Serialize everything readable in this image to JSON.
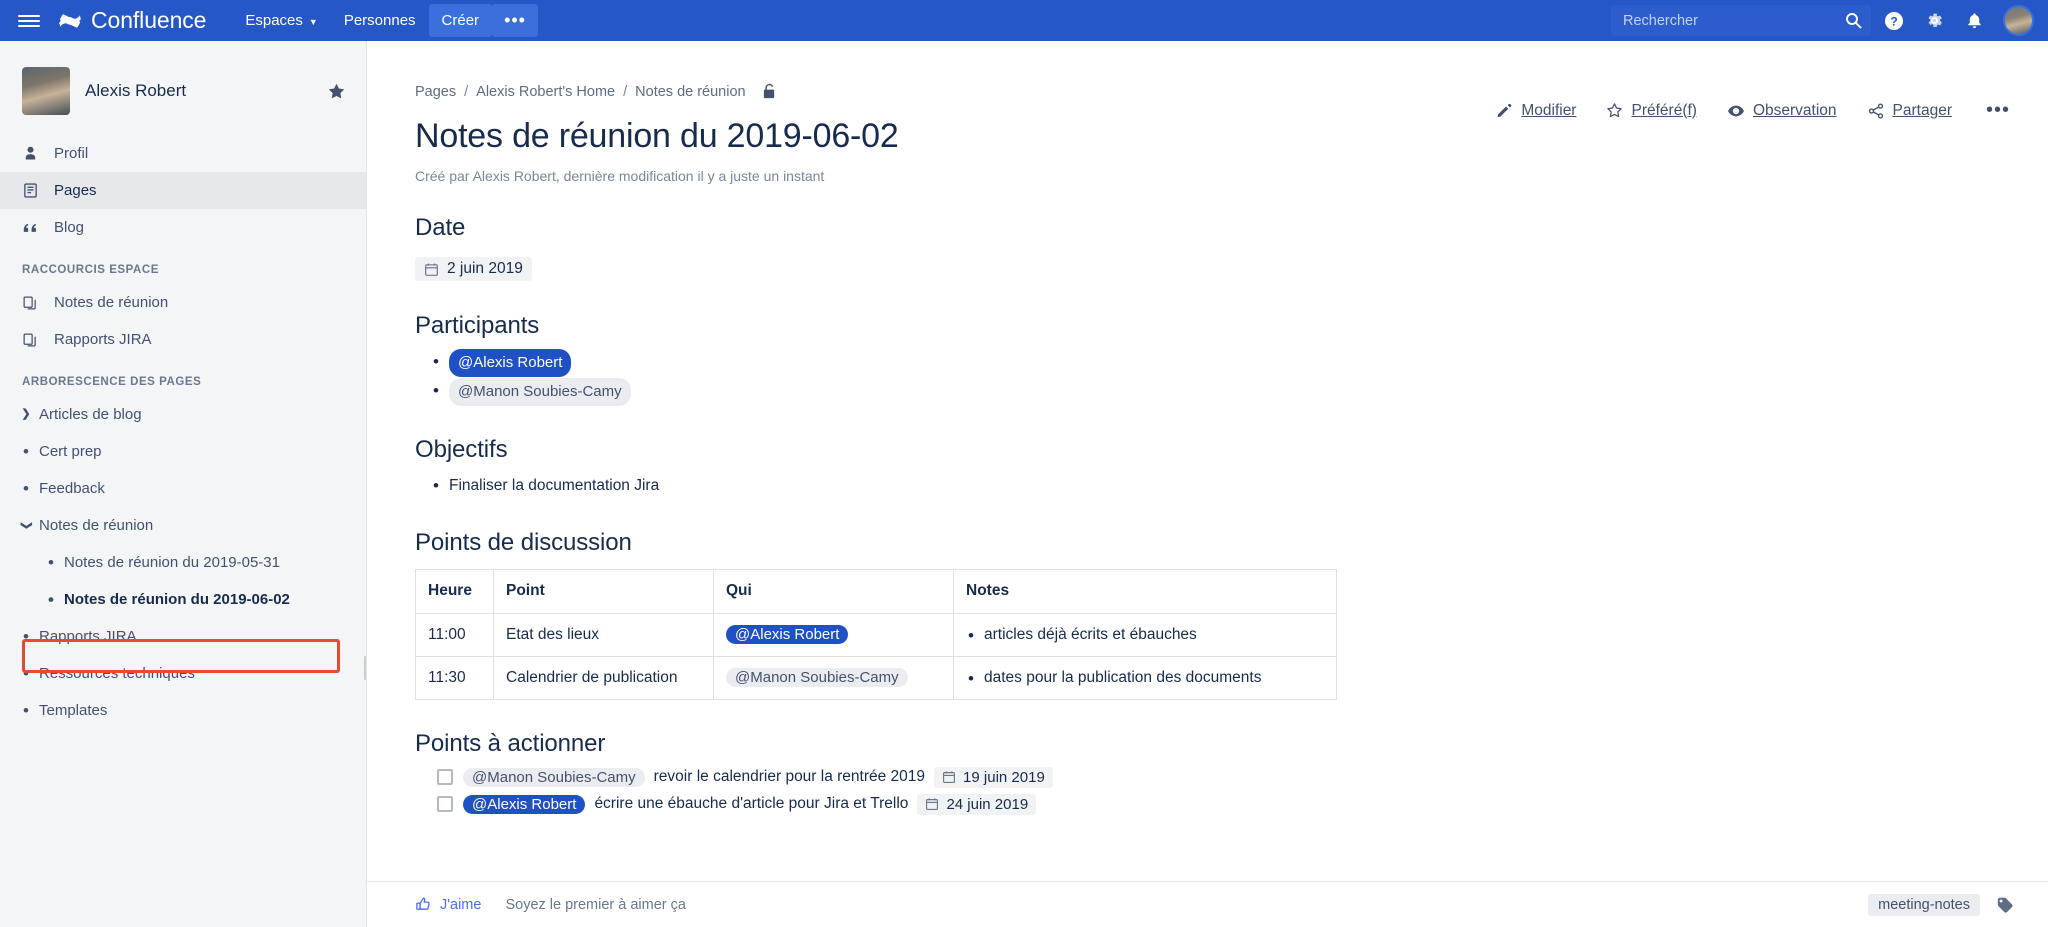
{
  "topnav": {
    "menu_icon": "hamburger-icon",
    "brand": "Confluence",
    "brand_logo_icon": "confluence-logo-icon",
    "items": [
      {
        "label": "Espaces",
        "has_caret": true
      },
      {
        "label": "Personnes",
        "has_caret": false
      }
    ],
    "create_label": "Créer",
    "more_label": "•••",
    "search": {
      "placeholder": "Rechercher",
      "value": "",
      "icon": "search-icon"
    },
    "help_icon": "help-circle-icon",
    "settings_icon": "gear-icon",
    "notifications_icon": "bell-icon",
    "avatar": "user-avatar"
  },
  "sidebar": {
    "space_name": "Alexis Robert",
    "star_icon": "star-filled-icon",
    "nav": [
      {
        "label": "Profil",
        "icon": "person-icon",
        "active": false
      },
      {
        "label": "Pages",
        "icon": "page-icon",
        "active": true
      },
      {
        "label": "Blog",
        "icon": "quote-icon",
        "active": false
      }
    ],
    "shortcuts_title": "RACCOURCIS ESPACE",
    "shortcuts": [
      {
        "label": "Notes de réunion",
        "icon": "copy-page-icon"
      },
      {
        "label": "Rapports JIRA",
        "icon": "copy-page-icon"
      }
    ],
    "tree_title": "ARBORESCENCE DES PAGES",
    "tree": [
      {
        "label": "Articles de blog",
        "marker": "chevron-right",
        "level": 1,
        "current": false
      },
      {
        "label": "Cert prep",
        "marker": "dot",
        "level": 1,
        "current": false
      },
      {
        "label": "Feedback",
        "marker": "dot",
        "level": 1,
        "current": false
      },
      {
        "label": "Notes de réunion",
        "marker": "chevron-down",
        "level": 1,
        "current": false
      },
      {
        "label": "Notes de réunion du 2019-05-31",
        "marker": "dot",
        "level": 2,
        "current": false
      },
      {
        "label": "Notes de réunion du 2019-06-02",
        "marker": "dot",
        "level": 2,
        "current": true
      },
      {
        "label": "Rapports JIRA",
        "marker": "dot",
        "level": 1,
        "current": false
      },
      {
        "label": "Ressources techniques",
        "marker": "dot",
        "level": 1,
        "current": false
      },
      {
        "label": "Templates",
        "marker": "dot",
        "level": 1,
        "current": false
      }
    ],
    "highlight_color": "#e8492f"
  },
  "page": {
    "breadcrumb": [
      {
        "label": "Pages"
      },
      {
        "label": "Alexis Robert's Home"
      },
      {
        "label": "Notes de réunion"
      }
    ],
    "breadcrumb_sep": "/",
    "restrictions_icon": "lock-unlocked-icon",
    "title": "Notes de réunion du 2019-06-02",
    "byline": "Créé par Alexis Robert, dernière modification il y a juste un instant",
    "actions": [
      {
        "label": "Modifier",
        "icon": "pencil-icon",
        "underline_index": 0
      },
      {
        "label": "Préféré(f)",
        "icon": "star-outline-icon"
      },
      {
        "label": "Observation",
        "icon": "eye-icon"
      },
      {
        "label": "Partager",
        "icon": "share-icon"
      }
    ],
    "more_actions": "•••"
  },
  "content": {
    "date_heading": "Date",
    "date_value": "2 juin 2019",
    "date_icon": "calendar-icon",
    "participants_heading": "Participants",
    "participants": [
      {
        "name": "@Alexis Robert",
        "style": "me"
      },
      {
        "name": "@Manon Soubies-Camy",
        "style": "other"
      }
    ],
    "objectifs_heading": "Objectifs",
    "objectifs": [
      "Finaliser la documentation Jira"
    ],
    "discussion_heading": "Points de discussion",
    "table": {
      "headers": [
        "Heure",
        "Point",
        "Qui",
        "Notes"
      ],
      "rows": [
        {
          "heure": "11:00",
          "point": "Etat des lieux",
          "qui": "@Alexis Robert",
          "qui_style": "me",
          "notes": [
            "articles déjà écrits et ébauches"
          ]
        },
        {
          "heure": "11:30",
          "point": "Calendrier de publication",
          "qui": "@Manon Soubies-Camy",
          "qui_style": "other",
          "notes": [
            "dates pour la publication des documents"
          ]
        }
      ]
    },
    "actions_heading": "Points à actionner",
    "action_items": [
      {
        "checked": false,
        "mention": "@Manon Soubies-Camy",
        "mention_style": "other",
        "text": "revoir le calendrier pour la rentrée 2019",
        "date": "19 juin 2019",
        "date_icon": "calendar-icon"
      },
      {
        "checked": false,
        "mention": "@Alexis Robert",
        "mention_style": "me",
        "text": "écrire une ébauche d'article pour Jira et Trello",
        "date": "24 juin 2019",
        "date_icon": "calendar-icon"
      }
    ]
  },
  "footer": {
    "like_label": "J'aime",
    "like_icon": "thumbs-up-icon",
    "like_sub": "Soyez le premier à aimer ça",
    "tag": "meeting-notes",
    "tag_icon": "label-tag-icon"
  },
  "colors": {
    "nav_blue": "#2557c7",
    "accent_blue": "#2051c4",
    "sidebar_bg": "#f4f5f7",
    "text_dark": "#172b4d",
    "text_muted": "#6b778c",
    "highlight_red": "#e8492f"
  }
}
